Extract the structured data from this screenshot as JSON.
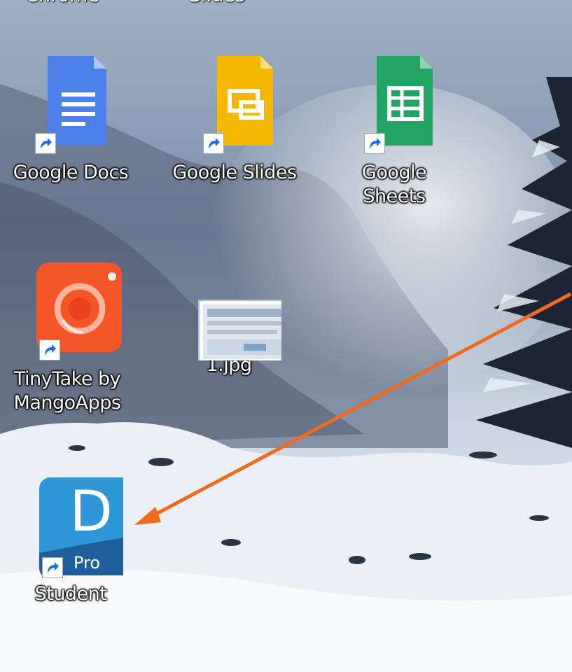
{
  "desktop": {
    "icons": [
      {
        "label": "Google Docs",
        "icon": "google-docs-icon",
        "color": "#4a80e8"
      },
      {
        "label": "Google Slides",
        "icon": "google-slides-icon",
        "color": "#f5b800"
      },
      {
        "label": "Google\nSheets",
        "icon": "google-sheets-icon",
        "color": "#21a464"
      },
      {
        "label": "TinyTake by\nMangoApps",
        "icon": "tinytake-icon",
        "color": "#f4562a"
      },
      {
        "label": "1.jpg",
        "icon": "image-thumbnail-icon",
        "color": "#dfe6ee"
      },
      {
        "label": "Student",
        "icon": "dpro-icon",
        "color": "#2f97d8",
        "badge": "Pro",
        "letter": "D"
      }
    ],
    "top_cut_labels": [
      "Chrome",
      "Slides"
    ],
    "annotation": {
      "type": "arrow",
      "color": "#f26a1b"
    }
  }
}
